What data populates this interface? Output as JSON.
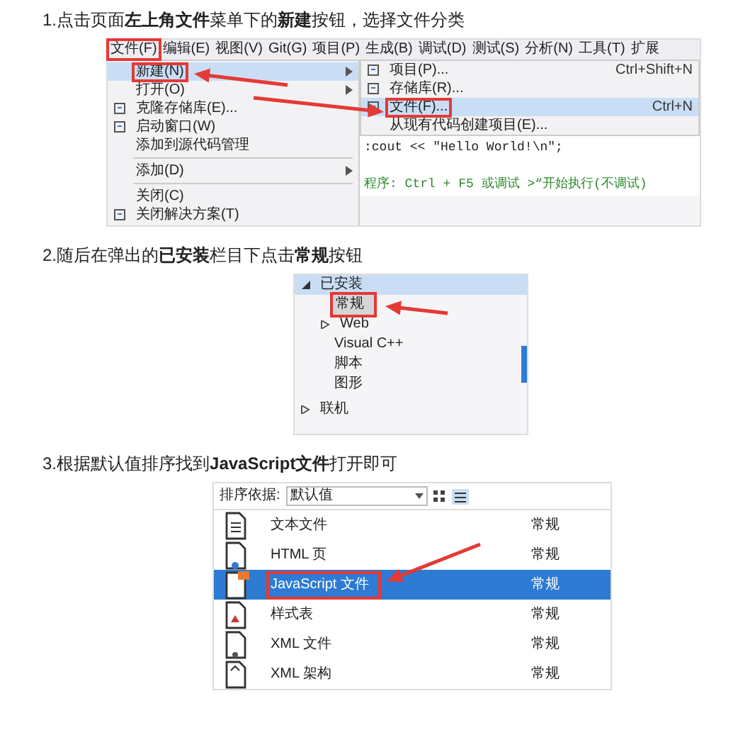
{
  "steps": [
    {
      "text": "1.点击页面**左上角文件**菜单下的**新建**按钮，选择文件分类",
      "screenshot": {
        "kind": "menu",
        "menubar": [
          {
            "label": "文件(F)",
            "boxed": true
          },
          {
            "label": "编辑(E)",
            "boxed": false
          },
          {
            "label": "视图(V)",
            "boxed": false
          },
          {
            "label": "Git(G)",
            "boxed": false
          },
          {
            "label": "项目(P)",
            "boxed": false
          },
          {
            "label": "生成(B)",
            "boxed": false
          },
          {
            "label": "调试(D)",
            "boxed": false
          },
          {
            "label": "测试(S)",
            "boxed": false
          },
          {
            "label": "分析(N)",
            "boxed": false
          },
          {
            "label": "工具(T)",
            "boxed": false
          },
          {
            "label": "扩展",
            "boxed": false
          }
        ],
        "menu": [
          {
            "kind": "item",
            "label": "新建(N)",
            "icon": false,
            "submenu": true,
            "selected": true,
            "boxed": true,
            "arrow": true
          },
          {
            "kind": "item",
            "label": "打开(O)",
            "icon": false,
            "submenu": true,
            "selected": false,
            "boxed": false
          },
          {
            "kind": "item",
            "label": "克隆存储库(E)...",
            "icon": true,
            "submenu": false,
            "selected": false,
            "boxed": false
          },
          {
            "kind": "item",
            "label": "启动窗口(W)",
            "icon": true,
            "submenu": false,
            "selected": false,
            "boxed": false
          },
          {
            "kind": "item",
            "label": "添加到源代码管理",
            "icon": false,
            "submenu": false,
            "selected": false,
            "boxed": false
          },
          {
            "kind": "separator"
          },
          {
            "kind": "item",
            "label": "添加(D)",
            "icon": false,
            "submenu": true,
            "selected": false,
            "boxed": false
          },
          {
            "kind": "separator"
          },
          {
            "kind": "item",
            "label": "关闭(C)",
            "icon": false,
            "submenu": false,
            "selected": false,
            "boxed": false
          },
          {
            "kind": "item",
            "label": "关闭解决方案(T)",
            "icon": true,
            "submenu": false,
            "selected": false,
            "boxed": false
          }
        ],
        "submenu": [
          {
            "label": "项目(P)...",
            "shortcut": "Ctrl+Shift+N",
            "icon": true,
            "selected": false,
            "boxed": false
          },
          {
            "label": "存储库(R)...",
            "icon": true,
            "selected": false,
            "boxed": false
          },
          {
            "label": "文件(F)...",
            "shortcut": "Ctrl+N",
            "icon": true,
            "selected": true,
            "boxed": true,
            "arrow": true
          },
          {
            "label": "从现有代码创建项目(E)...",
            "icon": false,
            "selected": false,
            "boxed": false
          }
        ],
        "code": [
          {
            "kind": "code",
            "text": ":cout << \"Hello World!\\n\";"
          },
          {
            "kind": "comment",
            "text": "程序: Ctrl + F5 或调试 >“开始执行(不调试)"
          }
        ]
      }
    },
    {
      "text": "2.随后在弹出的**已安装**栏目下点击**常规**按钮",
      "screenshot": {
        "kind": "tree",
        "tree": [
          {
            "label": "已安装",
            "expanded": true,
            "selected": false,
            "children": [
              {
                "label": "常规",
                "selected": true,
                "boxed": true,
                "arrow": true
              },
              {
                "label": "Web",
                "expanded": false,
                "selected": false
              },
              {
                "label": "Visual C++",
                "selected": false
              },
              {
                "label": "脚本",
                "selected": false
              },
              {
                "label": "图形",
                "selected": false
              }
            ]
          },
          {
            "label": "联机",
            "expanded": false,
            "selected": false
          }
        ]
      }
    },
    {
      "text": "3.根据默认值排序找到**JavaScript文件**打开即可",
      "screenshot": {
        "kind": "list",
        "sort_label": "排序依据:",
        "sort_value": "默认值",
        "rows": [
          {
            "kind": "text",
            "name": "文本文件",
            "category": "常规",
            "selected": false,
            "boxed": false
          },
          {
            "kind": "html",
            "name": "HTML 页",
            "category": "常规",
            "selected": false,
            "boxed": false
          },
          {
            "kind": "js",
            "name": "JavaScript 文件",
            "category": "常规",
            "selected": true,
            "boxed": true,
            "arrow": true
          },
          {
            "kind": "css",
            "name": "样式表",
            "category": "常规",
            "selected": false,
            "boxed": false
          },
          {
            "kind": "xml",
            "name": "XML 文件",
            "category": "常规",
            "selected": false,
            "boxed": false
          },
          {
            "kind": "schema",
            "name": "XML 架构",
            "category": "常规",
            "selected": false,
            "boxed": false
          }
        ]
      }
    }
  ]
}
